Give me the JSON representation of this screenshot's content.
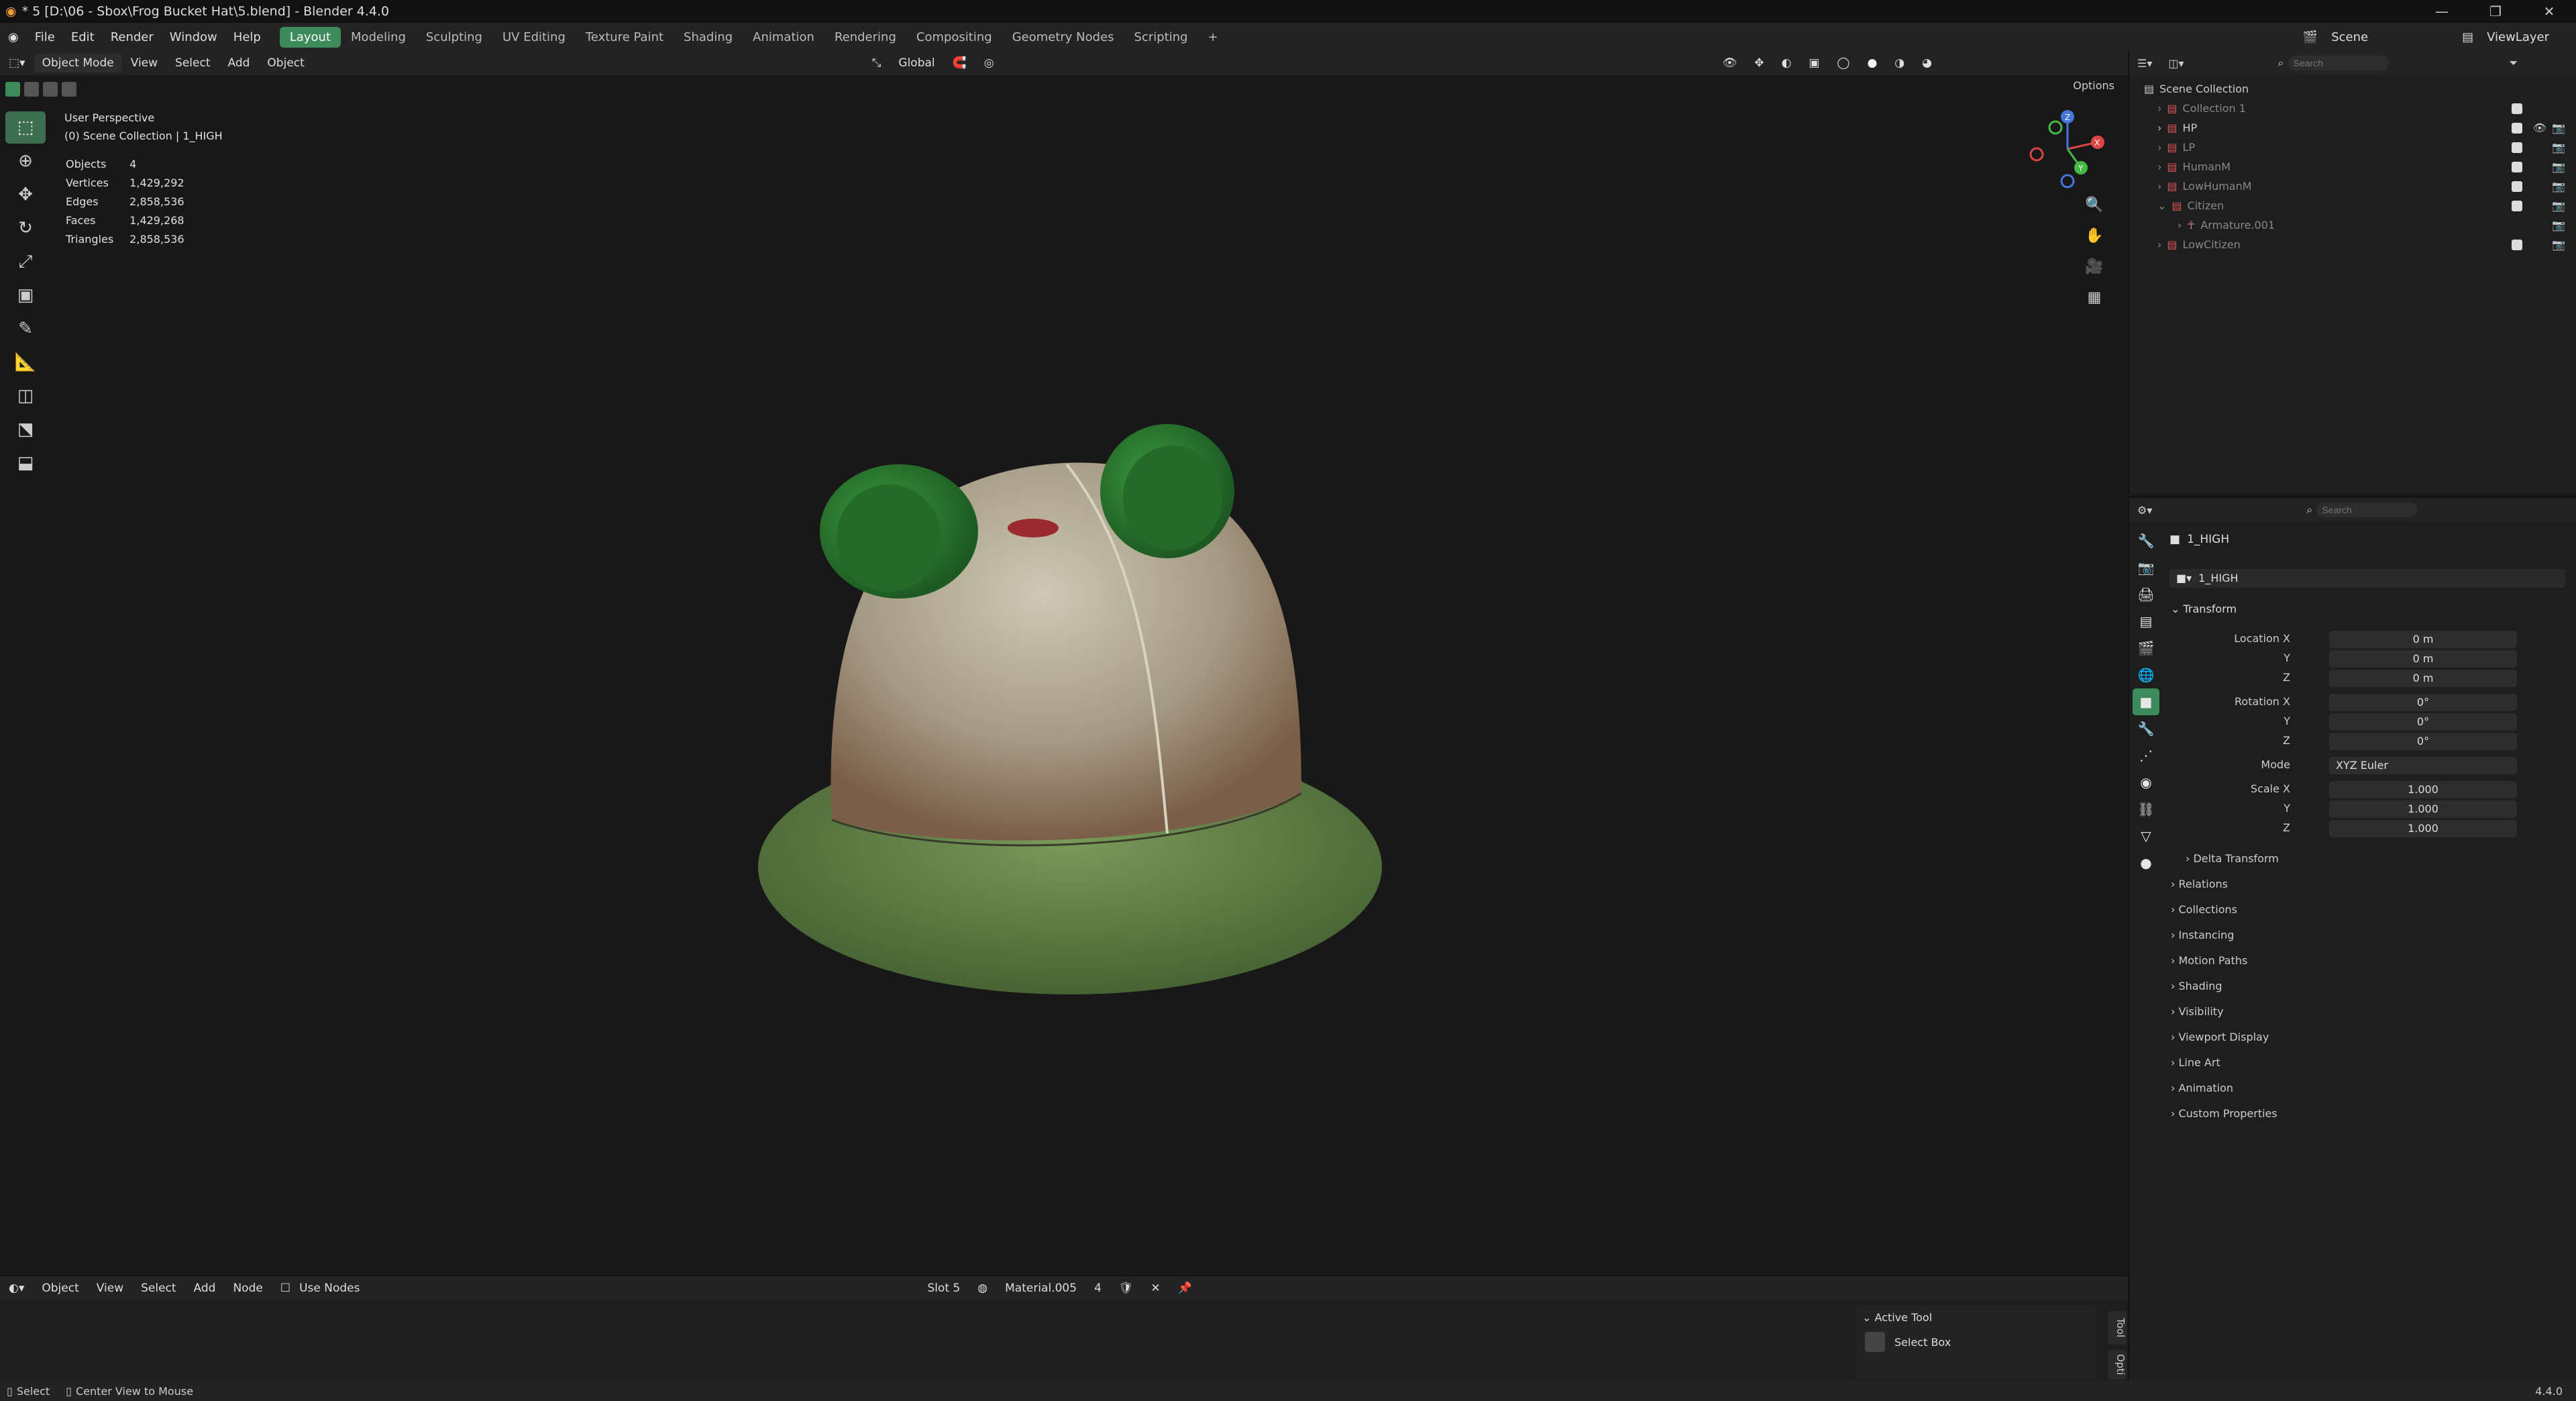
{
  "title": "* 5 [D:\\06 - Sbox\\Frog Bucket Hat\\5.blend] - Blender 4.4.0",
  "window_controls": [
    "—",
    "❐",
    "✕"
  ],
  "menu": [
    "File",
    "Edit",
    "Render",
    "Window",
    "Help"
  ],
  "workspaces": [
    "Layout",
    "Modeling",
    "Sculpting",
    "UV Editing",
    "Texture Paint",
    "Shading",
    "Animation",
    "Rendering",
    "Compositing",
    "Geometry Nodes",
    "Scripting",
    "+"
  ],
  "active_workspace": "Layout",
  "scene_label": "Scene",
  "viewlayer_label": "ViewLayer",
  "viewport_header": {
    "mode": "Object Mode",
    "menus": [
      "View",
      "Select",
      "Add",
      "Object"
    ],
    "orientation": "Global",
    "options": "Options"
  },
  "viewport": {
    "perspective": "User Perspective",
    "collection_info": "(0) Scene Collection | 1_HIGH",
    "stats": [
      {
        "label": "Objects",
        "value": "4"
      },
      {
        "label": "Vertices",
        "value": "1,429,292"
      },
      {
        "label": "Edges",
        "value": "2,858,536"
      },
      {
        "label": "Faces",
        "value": "1,429,268"
      },
      {
        "label": "Triangles",
        "value": "2,858,536"
      }
    ],
    "gizmo_axes": [
      "X",
      "Y",
      "Z"
    ]
  },
  "outliner": {
    "search_placeholder": "Search",
    "root": "Scene Collection",
    "items": [
      {
        "label": "Collection 1",
        "visible": false
      },
      {
        "label": "HP",
        "visible": true
      },
      {
        "label": "LP",
        "visible": true
      },
      {
        "label": "HumanM",
        "visible": true
      },
      {
        "label": "LowHumanM",
        "visible": true
      },
      {
        "label": "Citizen",
        "visible": true
      },
      {
        "label": "Armature.001",
        "visible": false
      },
      {
        "label": "LowCitizen",
        "visible": true
      }
    ]
  },
  "properties": {
    "search_placeholder": "Search",
    "object_name": "1_HIGH",
    "object_data_name": "1_HIGH",
    "transform_title": "Transform",
    "location_label": "Location X",
    "rotation_label": "Rotation X",
    "scale_label": "Scale X",
    "mode_label": "Mode",
    "axis_y": "Y",
    "axis_z": "Z",
    "location": [
      "0 m",
      "0 m",
      "0 m"
    ],
    "rotation": [
      "0°",
      "0°",
      "0°"
    ],
    "mode_value": "XYZ Euler",
    "scale": [
      "1.000",
      "1.000",
      "1.000"
    ],
    "delta": "Delta Transform",
    "sections": [
      "Relations",
      "Collections",
      "Instancing",
      "Motion Paths",
      "Shading",
      "Visibility",
      "Viewport Display",
      "Line Art",
      "Animation",
      "Custom Properties"
    ]
  },
  "node_header": {
    "type": "Object",
    "menus": [
      "View",
      "Select",
      "Add",
      "Node"
    ],
    "use_nodes": "Use Nodes",
    "slot": "Slot 5",
    "material": "Material.005",
    "users": "4"
  },
  "active_tool": {
    "title": "Active Tool",
    "name": "Select Box",
    "tab_tool": "Tool",
    "tab_options": "Opti"
  },
  "status": {
    "select": "Select",
    "center": "Center View to Mouse",
    "version": "4.4.0"
  },
  "colors": {
    "accent": "#3d8a5a",
    "hat_crown": "#b8b09a",
    "hat_brim": "#5e7a45",
    "ears": "#2f7a35"
  }
}
